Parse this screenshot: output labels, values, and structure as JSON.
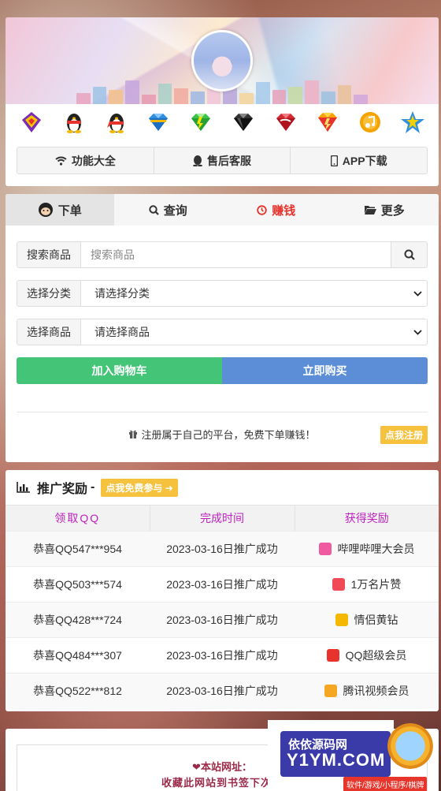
{
  "top": {
    "icons": [
      "diamond-icon",
      "qq-penguin-icon",
      "qq-red-penguin-icon",
      "blue-diamond-icon",
      "green-diamond-icon",
      "black-diamond-icon",
      "red-diamond-icon",
      "yellow-diamond-icon",
      "music-icon",
      "star-icon"
    ],
    "buttons": {
      "features": "功能大全",
      "service": "售后客服",
      "app": "APP下载"
    }
  },
  "tabs": {
    "order": "下单",
    "query": "查询",
    "earn": "赚钱",
    "more": "更多"
  },
  "form": {
    "search_label": "搜索商品",
    "search_placeholder": "搜索商品",
    "category_label": "选择分类",
    "category_value": "请选择分类",
    "product_label": "选择商品",
    "product_value": "请选择商品",
    "cart_button": "加入购物车",
    "buy_button": "立即购买",
    "register_text": "注册属于自己的平台，免费下单赚钱！",
    "register_button": "点我注册"
  },
  "promo": {
    "title": "推广奖励",
    "dash": "-",
    "join_button": "点我免费参与",
    "headers": [
      "领取QQ",
      "完成时间",
      "获得奖励"
    ],
    "rows": [
      {
        "qq": "恭喜QQ547***954",
        "time": "2023-03-16日推广成功",
        "reward": "哔哩哔哩大会员",
        "color": "#ef5aa0"
      },
      {
        "qq": "恭喜QQ503***574",
        "time": "2023-03-16日推广成功",
        "reward": "1万名片赞",
        "color": "#ef4a55"
      },
      {
        "qq": "恭喜QQ428***724",
        "time": "2023-03-16日推广成功",
        "reward": "情侣黄钻",
        "color": "#f5b800"
      },
      {
        "qq": "恭喜QQ484***307",
        "time": "2023-03-16日推广成功",
        "reward": "QQ超级会员",
        "color": "#e8322c"
      },
      {
        "qq": "恭喜QQ522***812",
        "time": "2023-03-16日推广成功",
        "reward": "腾讯视频会员",
        "color": "#f5a623"
      }
    ]
  },
  "footer": {
    "site_label": "❤本站网址：",
    "bookmark_text": "收藏此网站到书签下次使"
  },
  "watermark": {
    "line1": "依依源码网",
    "line2": "Y1YM.COM",
    "line3": "软件/游戏/小程序/棋牌"
  }
}
